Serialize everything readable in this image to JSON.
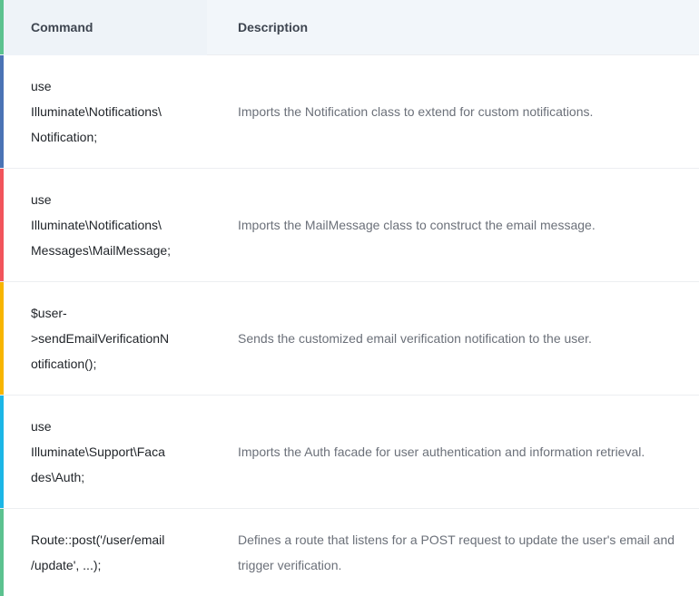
{
  "colors": {
    "header_bg": "#f2f6fa",
    "accent_row1": "#4a73b5",
    "accent_row2": "#f2545b",
    "accent_row3": "#f7b500",
    "accent_row4": "#1bb6e6",
    "accent_row5": "#5cc28f",
    "accent_header": "#5cc28f"
  },
  "table": {
    "headers": {
      "command": "Command",
      "description": "Description"
    },
    "rows": [
      {
        "command": "use\nIlluminate\\Notifications\\\nNotification;",
        "description": "Imports the Notification class to extend for custom notifications."
      },
      {
        "command": "use\nIlluminate\\Notifications\\\nMessages\\MailMessage;",
        "description": "Imports the MailMessage class to construct the email message."
      },
      {
        "command": "$user-\n>sendEmailVerificationN\notification();",
        "description": "Sends the customized email verification notification to the user."
      },
      {
        "command": "use\nIlluminate\\Support\\Faca\ndes\\Auth;",
        "description": "Imports the Auth facade for user authentication and information retrieval."
      },
      {
        "command": "Route::post('/user/email\n/update', ...);",
        "description": "Defines a route that listens for a POST request to update the user's email and trigger verification."
      }
    ]
  }
}
